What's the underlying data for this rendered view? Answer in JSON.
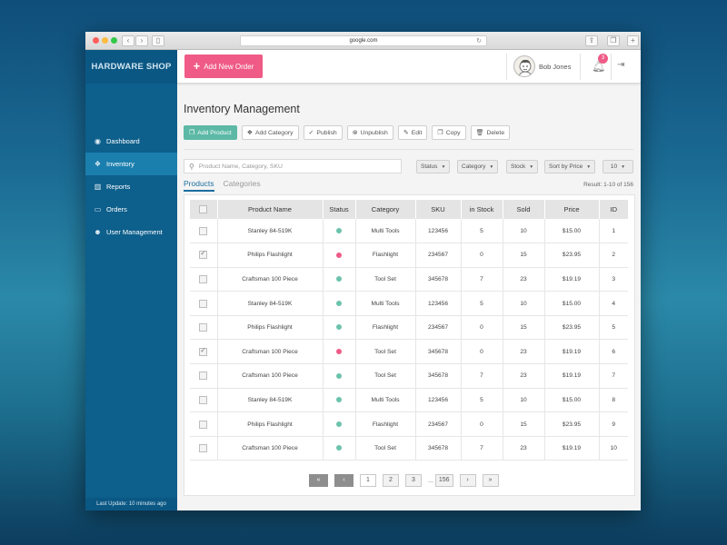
{
  "browser": {
    "url": "google.com"
  },
  "sidebar": {
    "brand": "HARDWARE SHOP",
    "items": [
      {
        "label": "Dashboard",
        "icon": "dashboard-icon"
      },
      {
        "label": "Inventory",
        "icon": "cubes-icon"
      },
      {
        "label": "Reports",
        "icon": "bar-chart-icon"
      },
      {
        "label": "Orders",
        "icon": "credit-card-icon"
      },
      {
        "label": "User Management",
        "icon": "users-icon"
      }
    ],
    "last_update": "Last Update: 10 minutes ago"
  },
  "header": {
    "add_order_label": "Add New Order",
    "user_name": "Bob Jones",
    "notification_count": "3"
  },
  "main": {
    "title": "Inventory Management",
    "toolbar": {
      "add_product": "Add Product",
      "add_category": "Add Category",
      "publish": "Publish",
      "unpublish": "Unpublish",
      "edit": "Edit",
      "copy": "Copy",
      "delete": "Delete"
    },
    "search": {
      "placeholder": "Product Name, Category, SKU"
    },
    "filters": {
      "status": "Status",
      "category": "Category",
      "stock": "Stock",
      "sort": "Sort by Price",
      "per_page": "10"
    },
    "tabs": {
      "products": "Products",
      "categories": "Categories"
    },
    "result": "Result: 1-10 of 156",
    "columns": {
      "name": "Product Name",
      "status": "Status",
      "category": "Category",
      "sku": "SKU",
      "stock": "in Stock",
      "sold": "Sold",
      "price": "Price",
      "id": "ID"
    },
    "rows": [
      {
        "checked": false,
        "name": "Stanley 84-519K",
        "status": "active",
        "category": "Multi Tools",
        "sku": "123456",
        "stock": "5",
        "sold": "10",
        "price": "$15.00",
        "id": "1"
      },
      {
        "checked": true,
        "name": "Philips Flashlight",
        "status": "inactive",
        "category": "Flashlight",
        "sku": "234567",
        "stock": "0",
        "sold": "15",
        "price": "$23.95",
        "id": "2"
      },
      {
        "checked": false,
        "name": "Craftsman 100 Piece",
        "status": "active",
        "category": "Tool Set",
        "sku": "345678",
        "stock": "7",
        "sold": "23",
        "price": "$19.19",
        "id": "3"
      },
      {
        "checked": false,
        "name": "Stanley 84-519K",
        "status": "active",
        "category": "Multi Tools",
        "sku": "123456",
        "stock": "5",
        "sold": "10",
        "price": "$15.00",
        "id": "4"
      },
      {
        "checked": false,
        "name": "Philips Flashlight",
        "status": "active",
        "category": "Flashlight",
        "sku": "234567",
        "stock": "0",
        "sold": "15",
        "price": "$23.95",
        "id": "5"
      },
      {
        "checked": true,
        "name": "Craftsman 100 Piece",
        "status": "inactive",
        "category": "Tool Set",
        "sku": "345678",
        "stock": "0",
        "sold": "23",
        "price": "$19.19",
        "id": "6"
      },
      {
        "checked": false,
        "name": "Craftsman 100 Piece",
        "status": "active",
        "category": "Tool Set",
        "sku": "345678",
        "stock": "7",
        "sold": "23",
        "price": "$19.19",
        "id": "7"
      },
      {
        "checked": false,
        "name": "Stanley 84-519K",
        "status": "active",
        "category": "Multi Tools",
        "sku": "123456",
        "stock": "5",
        "sold": "10",
        "price": "$15.00",
        "id": "8"
      },
      {
        "checked": false,
        "name": "Philips Flashlight",
        "status": "active",
        "category": "Flashlight",
        "sku": "234567",
        "stock": "0",
        "sold": "15",
        "price": "$23.95",
        "id": "9"
      },
      {
        "checked": false,
        "name": "Craftsman 100 Piece",
        "status": "active",
        "category": "Tool Set",
        "sku": "345678",
        "stock": "7",
        "sold": "23",
        "price": "$19.19",
        "id": "10"
      }
    ],
    "pagination": {
      "pages": [
        "1",
        "2",
        "3"
      ],
      "ellipsis": "...",
      "last": "156"
    }
  },
  "colors": {
    "active": "#6cc3ad",
    "inactive": "#ef5b86",
    "accent": "#ef5b86",
    "sidebar": "#0d5f8c",
    "primary_button": "#5cb9a6"
  }
}
